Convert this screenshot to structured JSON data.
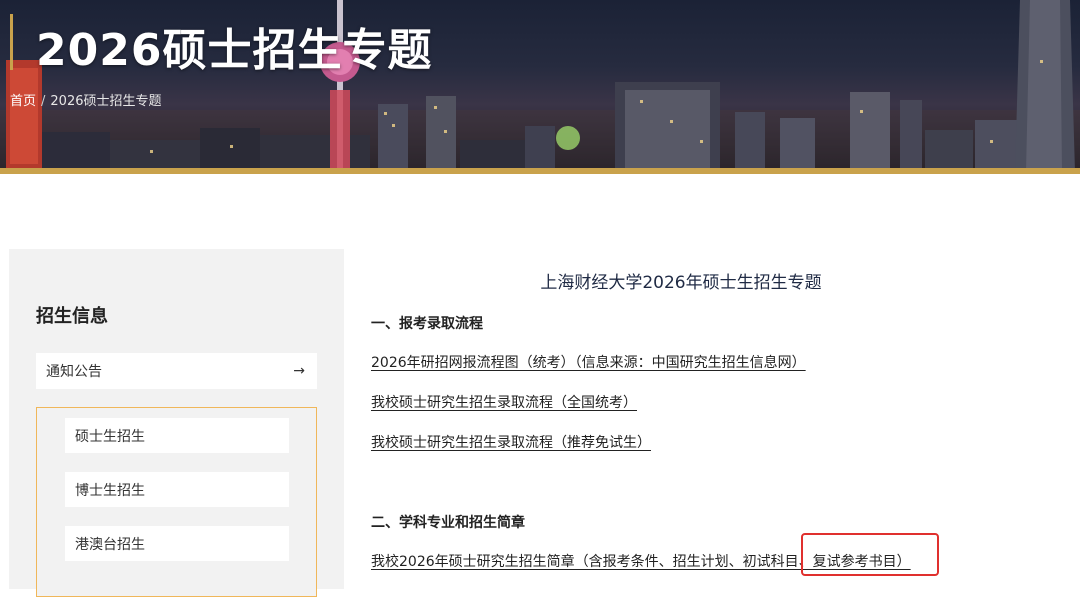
{
  "banner": {
    "title": "2026硕士招生专题",
    "breadcrumb": {
      "home": "首页",
      "separator": "/",
      "current": "2026硕士招生专题"
    }
  },
  "sidebar": {
    "heading": "招生信息",
    "notice": {
      "label": "通知公告",
      "arrow": "→"
    },
    "items": [
      {
        "label": "硕士生招生"
      },
      {
        "label": "博士生招生"
      },
      {
        "label": "港澳台招生"
      }
    ]
  },
  "main": {
    "title": "上海财经大学2026年硕士生招生专题",
    "sections": [
      {
        "heading": "一、报考录取流程",
        "links": [
          "2026年研招网报流程图（统考）（信息来源：中国研究生招生信息网）",
          "我校硕士研究生招生录取流程（全国统考）",
          "我校硕士研究生招生录取流程（推荐免试生）"
        ]
      },
      {
        "heading": "二、学科专业和招生简章",
        "links": [
          "我校2026年硕士研究生招生简章（含报考条件、招生计划、初试科目、复试参考书目）"
        ]
      }
    ]
  },
  "colors": {
    "gold": "#c9a24c",
    "highlight_red": "#e0302e",
    "sidebar_border": "#f0b75a"
  }
}
